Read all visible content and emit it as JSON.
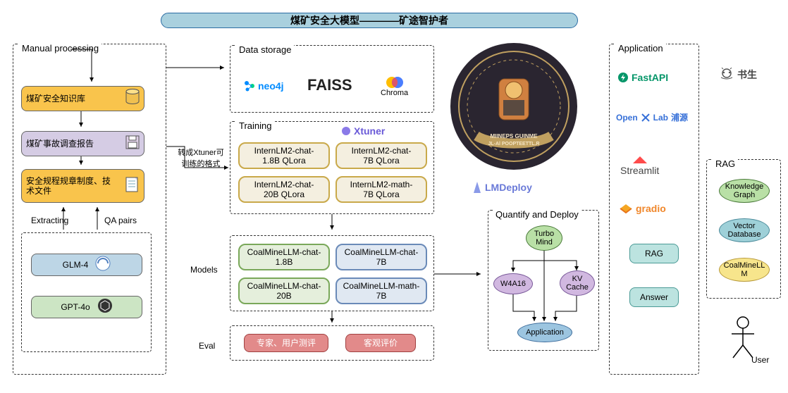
{
  "title": "煤矿安全大模型————矿途智护者",
  "manual": {
    "section_title": "Manual processing",
    "kb": "煤矿安全知识库",
    "report": "煤矿事故调查报告",
    "rules": "安全规程规章制度、技术文件",
    "extracting": "Extracting",
    "qa_pairs": "QA pairs",
    "glm4": "GLM-4",
    "gpt4o": "GPT-4o"
  },
  "arrow_label": "转成Xtuner可\n训练的格式",
  "storage": {
    "title": "Data storage",
    "neo4j": "neo4j",
    "faiss": "FAISS",
    "chroma": "Chroma"
  },
  "training": {
    "title": "Training",
    "xtuner": "Xtuner",
    "m1": "InternLM2-chat-\n1.8B QLora",
    "m2": "InternLM2-chat-\n7B QLora",
    "m3": "InternLM2-chat-\n20B QLora",
    "m4": "InternLM2-math-\n7B QLora"
  },
  "models": {
    "label": "Models",
    "m1": "CoalMineLLM-chat-\n1.8B",
    "m2": "CoalMineLLM-chat-\n7B",
    "m3": "CoalMineLLM-chat-\n20B",
    "m4": "CoalMineLLM-math-\n7B"
  },
  "eval": {
    "label": "Eval",
    "e1": "专家、用户测评",
    "e2": "客观评价"
  },
  "lmdeploy": "LMDeploy",
  "quantify": {
    "title": "Quantify and Deploy",
    "turbo": "Turbo\nMind",
    "w4a16": "W4A16",
    "kv": "KV\nCache",
    "app": "Application"
  },
  "application": {
    "title": "Application",
    "fastapi": "FastAPI",
    "openxlab": "OpenXLab浦源",
    "streamlit": "Streamlit",
    "gradio": "gradio",
    "rag": "RAG",
    "answer": "Answer"
  },
  "shusheng": "书生",
  "rag": {
    "title": "RAG",
    "kg": "Knowledge\nGraph",
    "vdb": "Vector\nDatabase",
    "cm": "CoalMineLL\nM"
  },
  "user": "User"
}
